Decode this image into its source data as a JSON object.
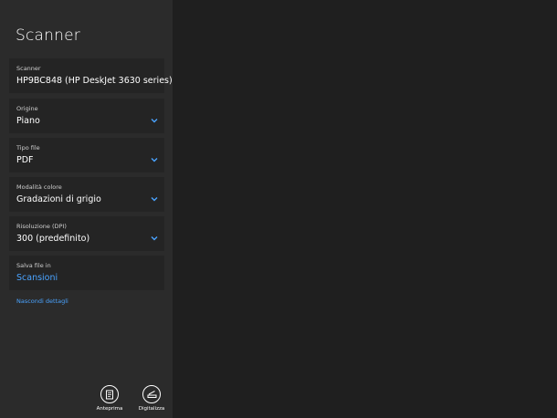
{
  "app": {
    "title": "Scanner"
  },
  "fields": [
    {
      "label": "Scanner",
      "value": "HP9BC848 (HP DeskJet 3630 series)",
      "dropdown": false
    },
    {
      "label": "Origine",
      "value": "Piano",
      "dropdown": true
    },
    {
      "label": "Tipo file",
      "value": "PDF",
      "dropdown": true
    },
    {
      "label": "Modalità colore",
      "value": "Gradazioni di grigio",
      "dropdown": true
    },
    {
      "label": "Risoluzione (DPI)",
      "value": "300 (predefinito)",
      "dropdown": true
    },
    {
      "label": "Salva file in",
      "value": "Scansioni",
      "dropdown": false
    }
  ],
  "details_link": "Nascondi dettagli",
  "actions": {
    "preview": {
      "label": "Anteprima",
      "icon": "preview-icon"
    },
    "scan": {
      "label": "Digitalizza",
      "icon": "scan-icon"
    }
  },
  "colors": {
    "accent": "#4aa3ff",
    "sidebar": "#2b2b2b",
    "panel": "#242424",
    "canvas": "#1f1f1f"
  }
}
